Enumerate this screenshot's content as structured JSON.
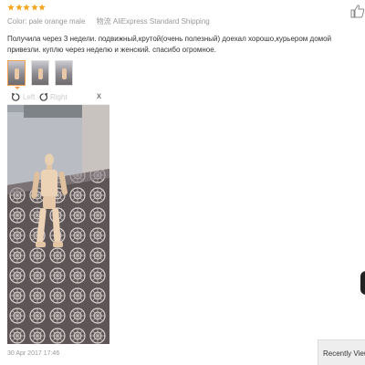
{
  "review": {
    "rating": 5,
    "color_label": "Color:",
    "color_value": "pale orange male",
    "shipping_label": "物流",
    "shipping_value": "AliExpress Standard Shipping",
    "text": "Получила через 3 недели. подвижный,крутой(очень полезный) доехал хорошо,курьером домой привезли. куплю через неделю и женский. спасибо огромное.",
    "thumbnails_count": 3,
    "date": "30 Apr 2017 17:46"
  },
  "viewer": {
    "rotate_left_label": "Left",
    "rotate_right_label": "Right",
    "close_label": "x"
  },
  "sidebar": {
    "recently_viewed_label": "Recently Viewe"
  },
  "colors": {
    "star": "#f5a623",
    "thumb_active_border": "#f0a050",
    "muted_text": "#999999"
  },
  "icons": {
    "rating": "star-icon",
    "like": "thumbs-up-icon",
    "rotate_left": "rotate-left-icon",
    "rotate_right": "rotate-right-icon",
    "close": "close-icon"
  }
}
